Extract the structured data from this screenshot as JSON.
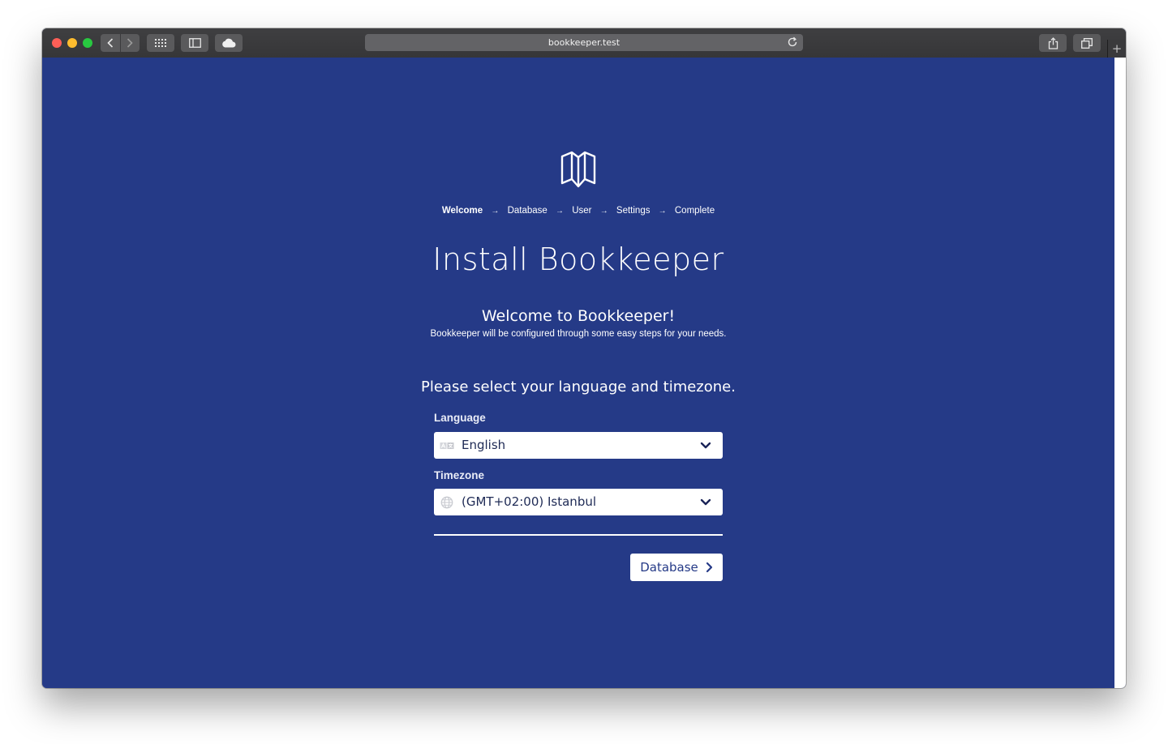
{
  "browser": {
    "url": "bookkeeper.test",
    "new_tab_symbol": "+"
  },
  "steps": [
    {
      "label": "Welcome",
      "active": true
    },
    {
      "label": "Database",
      "active": false
    },
    {
      "label": "User",
      "active": false
    },
    {
      "label": "Settings",
      "active": false
    },
    {
      "label": "Complete",
      "active": false
    }
  ],
  "step_separator": "→",
  "page": {
    "title": "Install Bookkeeper",
    "welcome_heading": "Welcome to Bookkeeper!",
    "welcome_text": "Bookkeeper will be configured through some easy steps for your needs.",
    "prompt": "Please select your language and timezone."
  },
  "form": {
    "language_label": "Language",
    "language_value": "English",
    "language_icon": "translate-icon",
    "timezone_label": "Timezone",
    "timezone_value": "(GMT+02:00) Istanbul",
    "timezone_icon": "globe-icon"
  },
  "next_button": {
    "label": "Database",
    "icon": "chevron-right-icon"
  },
  "colors": {
    "background": "#253a87",
    "text": "#ffffff",
    "button_text": "#253a87"
  }
}
